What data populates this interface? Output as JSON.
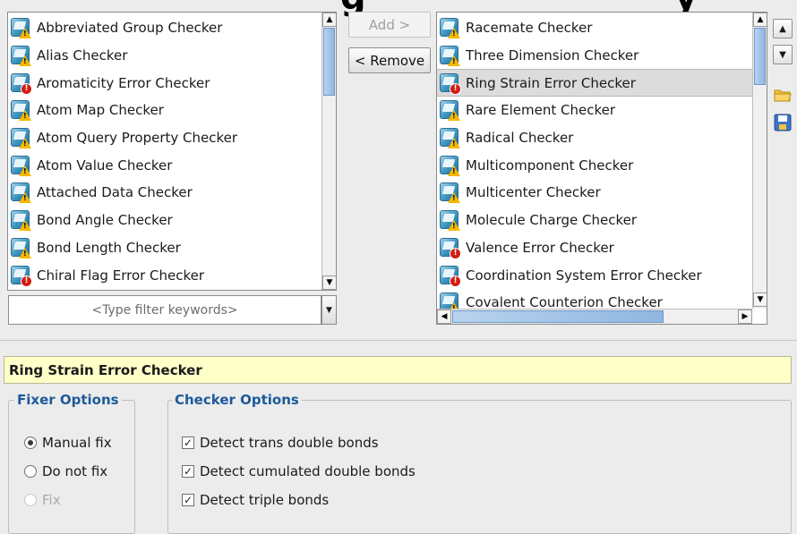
{
  "left_list": {
    "items": [
      {
        "label": "Abbreviated Group Checker",
        "icon": "warning-checker-icon"
      },
      {
        "label": "Alias Checker",
        "icon": "warning-checker-icon"
      },
      {
        "label": "Aromaticity Error Checker",
        "icon": "error-checker-icon"
      },
      {
        "label": "Atom Map Checker",
        "icon": "warning-checker-icon"
      },
      {
        "label": "Atom Query Property Checker",
        "icon": "warning-checker-icon"
      },
      {
        "label": "Atom Value Checker",
        "icon": "warning-checker-icon"
      },
      {
        "label": "Attached Data Checker",
        "icon": "warning-checker-icon"
      },
      {
        "label": "Bond Angle Checker",
        "icon": "warning-checker-icon"
      },
      {
        "label": "Bond Length Checker",
        "icon": "warning-checker-icon"
      },
      {
        "label": "Chiral Flag Error Checker",
        "icon": "error-checker-icon"
      }
    ]
  },
  "filter": {
    "placeholder": "<Type filter keywords>"
  },
  "buttons": {
    "add": "Add >",
    "remove": "< Remove"
  },
  "right_list": {
    "items": [
      {
        "label": "Racemate Checker",
        "icon": "warning-checker-icon",
        "selected": false
      },
      {
        "label": "Three Dimension Checker",
        "icon": "warning-checker-icon",
        "selected": false
      },
      {
        "label": "Ring Strain Error Checker",
        "icon": "error-checker-icon",
        "selected": true
      },
      {
        "label": "Rare Element Checker",
        "icon": "warning-checker-icon",
        "selected": false
      },
      {
        "label": "Radical Checker",
        "icon": "warning-checker-icon",
        "selected": false
      },
      {
        "label": "Multicomponent Checker",
        "icon": "warning-checker-icon",
        "selected": false
      },
      {
        "label": "Multicenter Checker",
        "icon": "warning-checker-icon",
        "selected": false
      },
      {
        "label": "Molecule Charge Checker",
        "icon": "warning-checker-icon",
        "selected": false
      },
      {
        "label": "Valence Error Checker",
        "icon": "error-checker-icon",
        "selected": false
      },
      {
        "label": "Coordination System Error Checker",
        "icon": "error-checker-icon",
        "selected": false
      },
      {
        "label": "Covalent Counterion Checker",
        "icon": "warning-checker-icon",
        "selected": false
      }
    ]
  },
  "selected_title": "Ring Strain Error Checker",
  "fixer_options": {
    "legend": "Fixer Options",
    "options": [
      {
        "label": "Manual fix",
        "checked": true,
        "enabled": true
      },
      {
        "label": "Do not fix",
        "checked": false,
        "enabled": true
      },
      {
        "label": "Fix",
        "checked": false,
        "enabled": false
      }
    ]
  },
  "checker_options": {
    "legend": "Checker Options",
    "options": [
      {
        "label": "Detect trans double bonds",
        "checked": true
      },
      {
        "label": "Detect cumulated double bonds",
        "checked": true
      },
      {
        "label": "Detect triple bonds",
        "checked": true
      }
    ]
  }
}
